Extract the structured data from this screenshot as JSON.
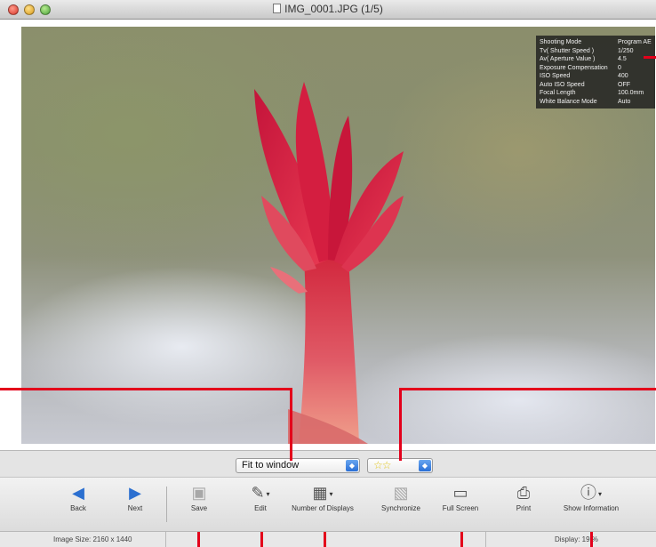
{
  "window": {
    "title": "IMG_0001.JPG (1/5)"
  },
  "shooting_info": [
    {
      "label": "Shooting Mode",
      "value": "Program AE"
    },
    {
      "label": "Tv( Shutter Speed )",
      "value": "1/250"
    },
    {
      "label": "Av( Aperture Value )",
      "value": "4.5"
    },
    {
      "label": "Exposure Compensation",
      "value": "0"
    },
    {
      "label": "ISO Speed",
      "value": "400"
    },
    {
      "label": "Auto ISO Speed",
      "value": "OFF"
    },
    {
      "label": "Focal Length",
      "value": "100.0mm"
    },
    {
      "label": "White Balance Mode",
      "value": "Auto"
    }
  ],
  "selectors": {
    "zoom": "Fit to window",
    "rating": "☆☆"
  },
  "toolbar": {
    "back": "Back",
    "next": "Next",
    "save": "Save",
    "edit": "Edit",
    "number_of_displays": "Number of Displays",
    "synchronize": "Synchronize",
    "full_screen": "Full Screen",
    "print": "Print",
    "show_information": "Show Information"
  },
  "status": {
    "image_size": "Image Size: 2160 x 1440",
    "display": "Display: 19 %"
  },
  "colors": {
    "callout_lines": "#e3001b",
    "select_arrow": "#2a6fd6",
    "nav_arrow": "#2b6fd0"
  }
}
